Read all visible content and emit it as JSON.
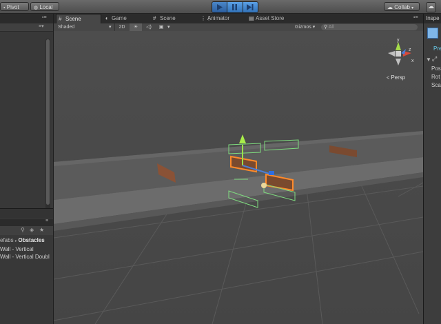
{
  "toolbar": {
    "pivot_label": "Pivot",
    "local_label": "Local",
    "collab_label": "Collab"
  },
  "tabs": [
    {
      "label": "Scene",
      "icon": "scene-icon"
    },
    {
      "label": "Game",
      "icon": "game-icon"
    },
    {
      "label": "Scene",
      "icon": "scene-icon"
    },
    {
      "label": "Animator",
      "icon": "animator-icon"
    },
    {
      "label": "Asset Store",
      "icon": "asset-store-icon"
    }
  ],
  "scene_controls": {
    "shading_mode": "Shaded",
    "mode_2d": "2D",
    "gizmos_label": "Gizmos",
    "search_placeholder": "All"
  },
  "viewport": {
    "projection_label": "Persp",
    "axis_y": "y",
    "axis_x": "x",
    "axis_z": "z"
  },
  "project": {
    "breadcrumb_parent": "efabs",
    "breadcrumb_current": "Obstacles",
    "items": [
      "Wall - Vertical",
      "Wall - Vertical Doubl"
    ]
  },
  "inspector": {
    "tab_label": "Inspe",
    "prefab_label": "Pre",
    "transform_fields": [
      "Pos",
      "Rot",
      "Sca"
    ]
  }
}
